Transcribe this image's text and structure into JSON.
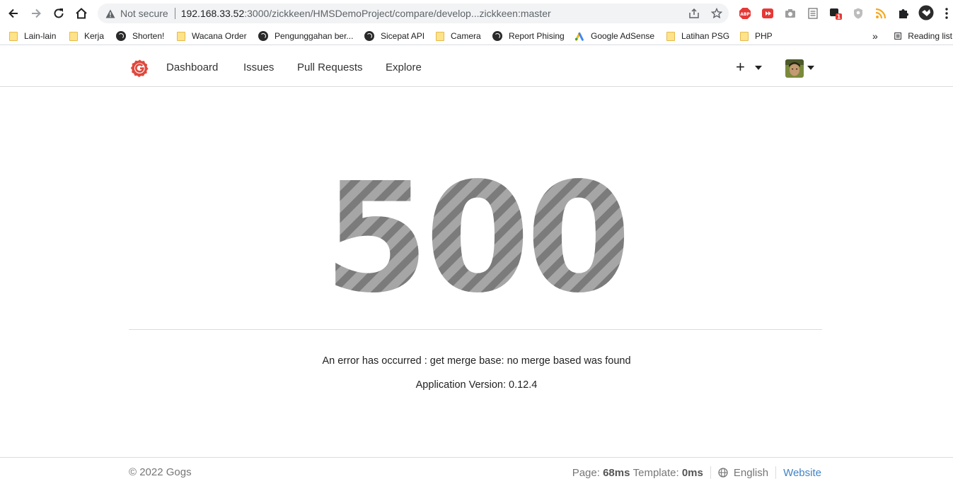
{
  "browser": {
    "omnibox": {
      "security": "Not secure",
      "url_host": "192.168.33.52",
      "url_rest": ":3000/zickkeen/HMSDemoProject/compare/develop...zickkeen:master"
    },
    "bookmarks": [
      {
        "label": "Lain-lain",
        "icon": "folder-icon"
      },
      {
        "label": "Kerja",
        "icon": "folder-icon"
      },
      {
        "label": "Shorten!",
        "icon": "globe-icon"
      },
      {
        "label": "Wacana Order",
        "icon": "folder-icon"
      },
      {
        "label": "Pengunggahan ber...",
        "icon": "globe-icon"
      },
      {
        "label": "Sicepat API",
        "icon": "globe-icon"
      },
      {
        "label": "Camera",
        "icon": "folder-icon"
      },
      {
        "label": "Report Phising",
        "icon": "globe-icon"
      },
      {
        "label": "Google AdSense",
        "icon": "adsense-icon"
      },
      {
        "label": "Latihan PSG",
        "icon": "folder-icon"
      },
      {
        "label": "PHP",
        "icon": "folder-icon"
      }
    ],
    "overflow": "»",
    "reading_list": "Reading list",
    "extensions": {
      "abp": "ABP",
      "badge": "1"
    }
  },
  "header": {
    "nav": [
      "Dashboard",
      "Issues",
      "Pull Requests",
      "Explore"
    ],
    "plus": "+"
  },
  "error": {
    "code": "500",
    "message": "An error has occurred : get merge base: no merge based was found",
    "version": "Application Version: 0.12.4"
  },
  "footer": {
    "copyright": "© 2022 Gogs",
    "page_label": "Page:",
    "page_time": "68ms",
    "template_label": "Template:",
    "template_time": "0ms",
    "language": "English",
    "website": "Website"
  },
  "colors": {
    "link": "#4183c4",
    "stripe_light": "#a6a6a6",
    "stripe_dark": "#7b7b7b",
    "logo": "#e0483d"
  }
}
